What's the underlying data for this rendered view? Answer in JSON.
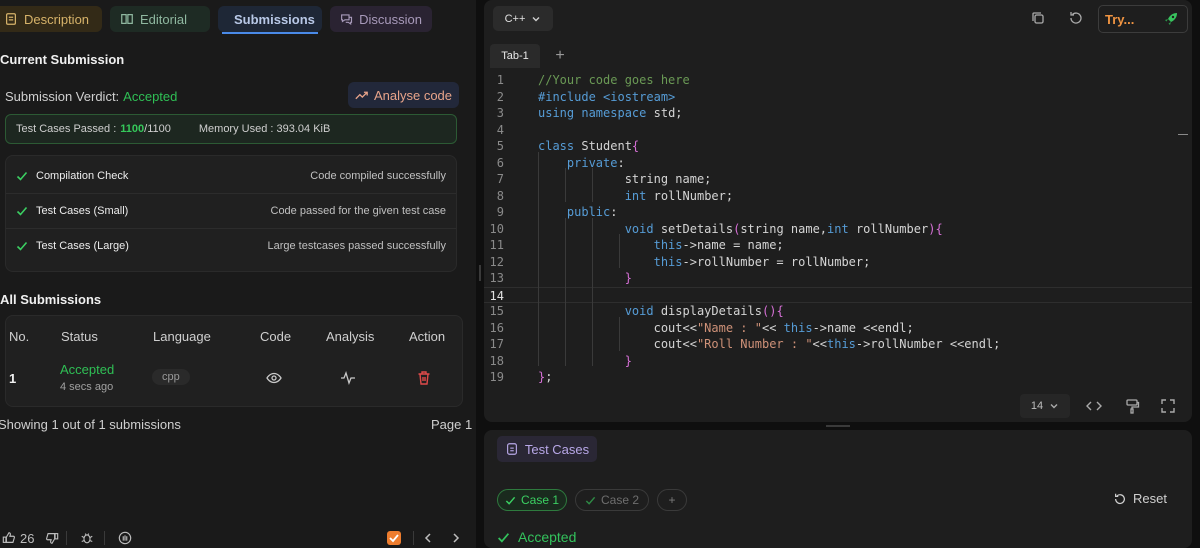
{
  "tabs": {
    "description": "Description",
    "editorial": "Editorial",
    "submissions": "Submissions",
    "discussion": "Discussion"
  },
  "current_submission": {
    "title": "Current Submission",
    "verdict_label": "Submission Verdict:",
    "verdict_value": "Accepted",
    "analyse_label": "Analyse code",
    "passed_label": "Test Cases Passed :",
    "passed_count": "1100",
    "passed_total": "/1100",
    "memory_label": "Memory Used : 393.04 KiB",
    "checks": [
      {
        "name": "Compilation Check",
        "message": "Code compiled successfully"
      },
      {
        "name": "Test Cases (Small)",
        "message": "Code passed for the given test case"
      },
      {
        "name": "Test Cases (Large)",
        "message": "Large testcases passed successfully"
      }
    ]
  },
  "all_submissions": {
    "title": "All Submissions",
    "headers": [
      "No.",
      "Status",
      "Language",
      "Code",
      "Analysis",
      "Action"
    ],
    "rows": [
      {
        "no": "1",
        "status": "Accepted",
        "time": "4 secs ago",
        "language": "cpp"
      }
    ],
    "showing_text": "Showing 1 out of 1 submissions",
    "page_text": "Page 1"
  },
  "footer": {
    "likes": "26"
  },
  "editor": {
    "language": "C++",
    "try_label": "Try...",
    "file_tab": "Tab-1",
    "add_tab": "+",
    "font_size": "14",
    "active_line": 14,
    "lines": [
      "//Your code goes here",
      "#include <iostream>",
      "using namespace std;",
      "",
      "class Student{",
      "    private:",
      "            string name;",
      "            int rollNumber;",
      "    public:",
      "            void setDetails(string name,int rollNumber){",
      "                this->name = name;",
      "                this->rollNumber = rollNumber;",
      "            }",
      "",
      "            void displayDetails(){",
      "                cout<<\"Name : \"<< this->name <<endl;",
      "                cout<<\"Roll Number : \"<<this->rollNumber <<endl;",
      "            }",
      "};"
    ]
  },
  "test_cases": {
    "tab_label": "Test Cases",
    "case1": "Case 1",
    "case2": "Case 2",
    "add": "+",
    "reset": "Reset",
    "status": "Accepted"
  },
  "colors": {
    "accepted": "#2fbf55",
    "accent_blue": "#4a8ae8",
    "try_orange": "#ef9442"
  }
}
